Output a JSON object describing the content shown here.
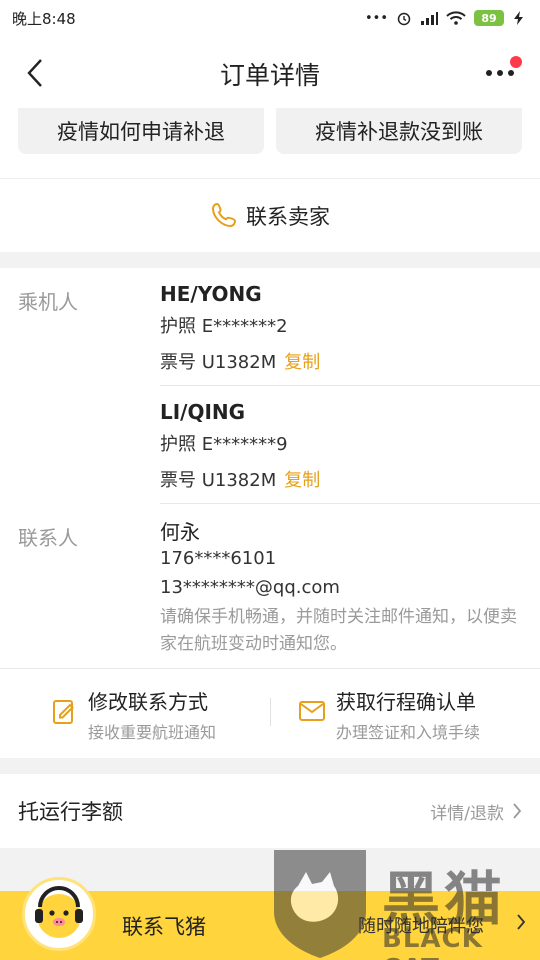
{
  "status_bar": {
    "time": "晚上8:48",
    "dots": "•••",
    "battery": "89"
  },
  "nav": {
    "title": "订单详情"
  },
  "quick_actions": [
    {
      "label": "疫情如何申请补退"
    },
    {
      "label": "疫情补退款没到账"
    }
  ],
  "contact_seller": {
    "label": "联系卖家"
  },
  "passengers": {
    "label": "乘机人",
    "items": [
      {
        "name": "HE/YONG",
        "passport": "护照 E*******2",
        "ticket": "票号 U1382M",
        "copy_label": "复制"
      },
      {
        "name": "LI/QING",
        "passport": "护照 E*******9",
        "ticket": "票号 U1382M",
        "copy_label": "复制"
      }
    ]
  },
  "contact": {
    "label": "联系人",
    "name": "何永",
    "phone": "176****6101",
    "email": "13********@qq.com",
    "note": "请确保手机畅通，并随时关注邮件通知，以便卖家在航班变动时通知您。"
  },
  "actions": [
    {
      "title": "修改联系方式",
      "subtitle": "接收重要航班通知",
      "icon": "edit-icon"
    },
    {
      "title": "获取行程确认单",
      "subtitle": "办理签证和入境手续",
      "icon": "mail-icon"
    }
  ],
  "luggage": {
    "title": "托运行李额",
    "link": "详情/退款"
  },
  "bottom_bar": {
    "label": "联系飞猪",
    "right_text": "随时随地陪伴您"
  },
  "watermark": {
    "cn": "黑猫",
    "en": "BLACK CAT"
  },
  "colors": {
    "accent": "#e6a01a",
    "bottom_bar": "#ffd43c",
    "notify_dot": "#ff3b4a"
  }
}
